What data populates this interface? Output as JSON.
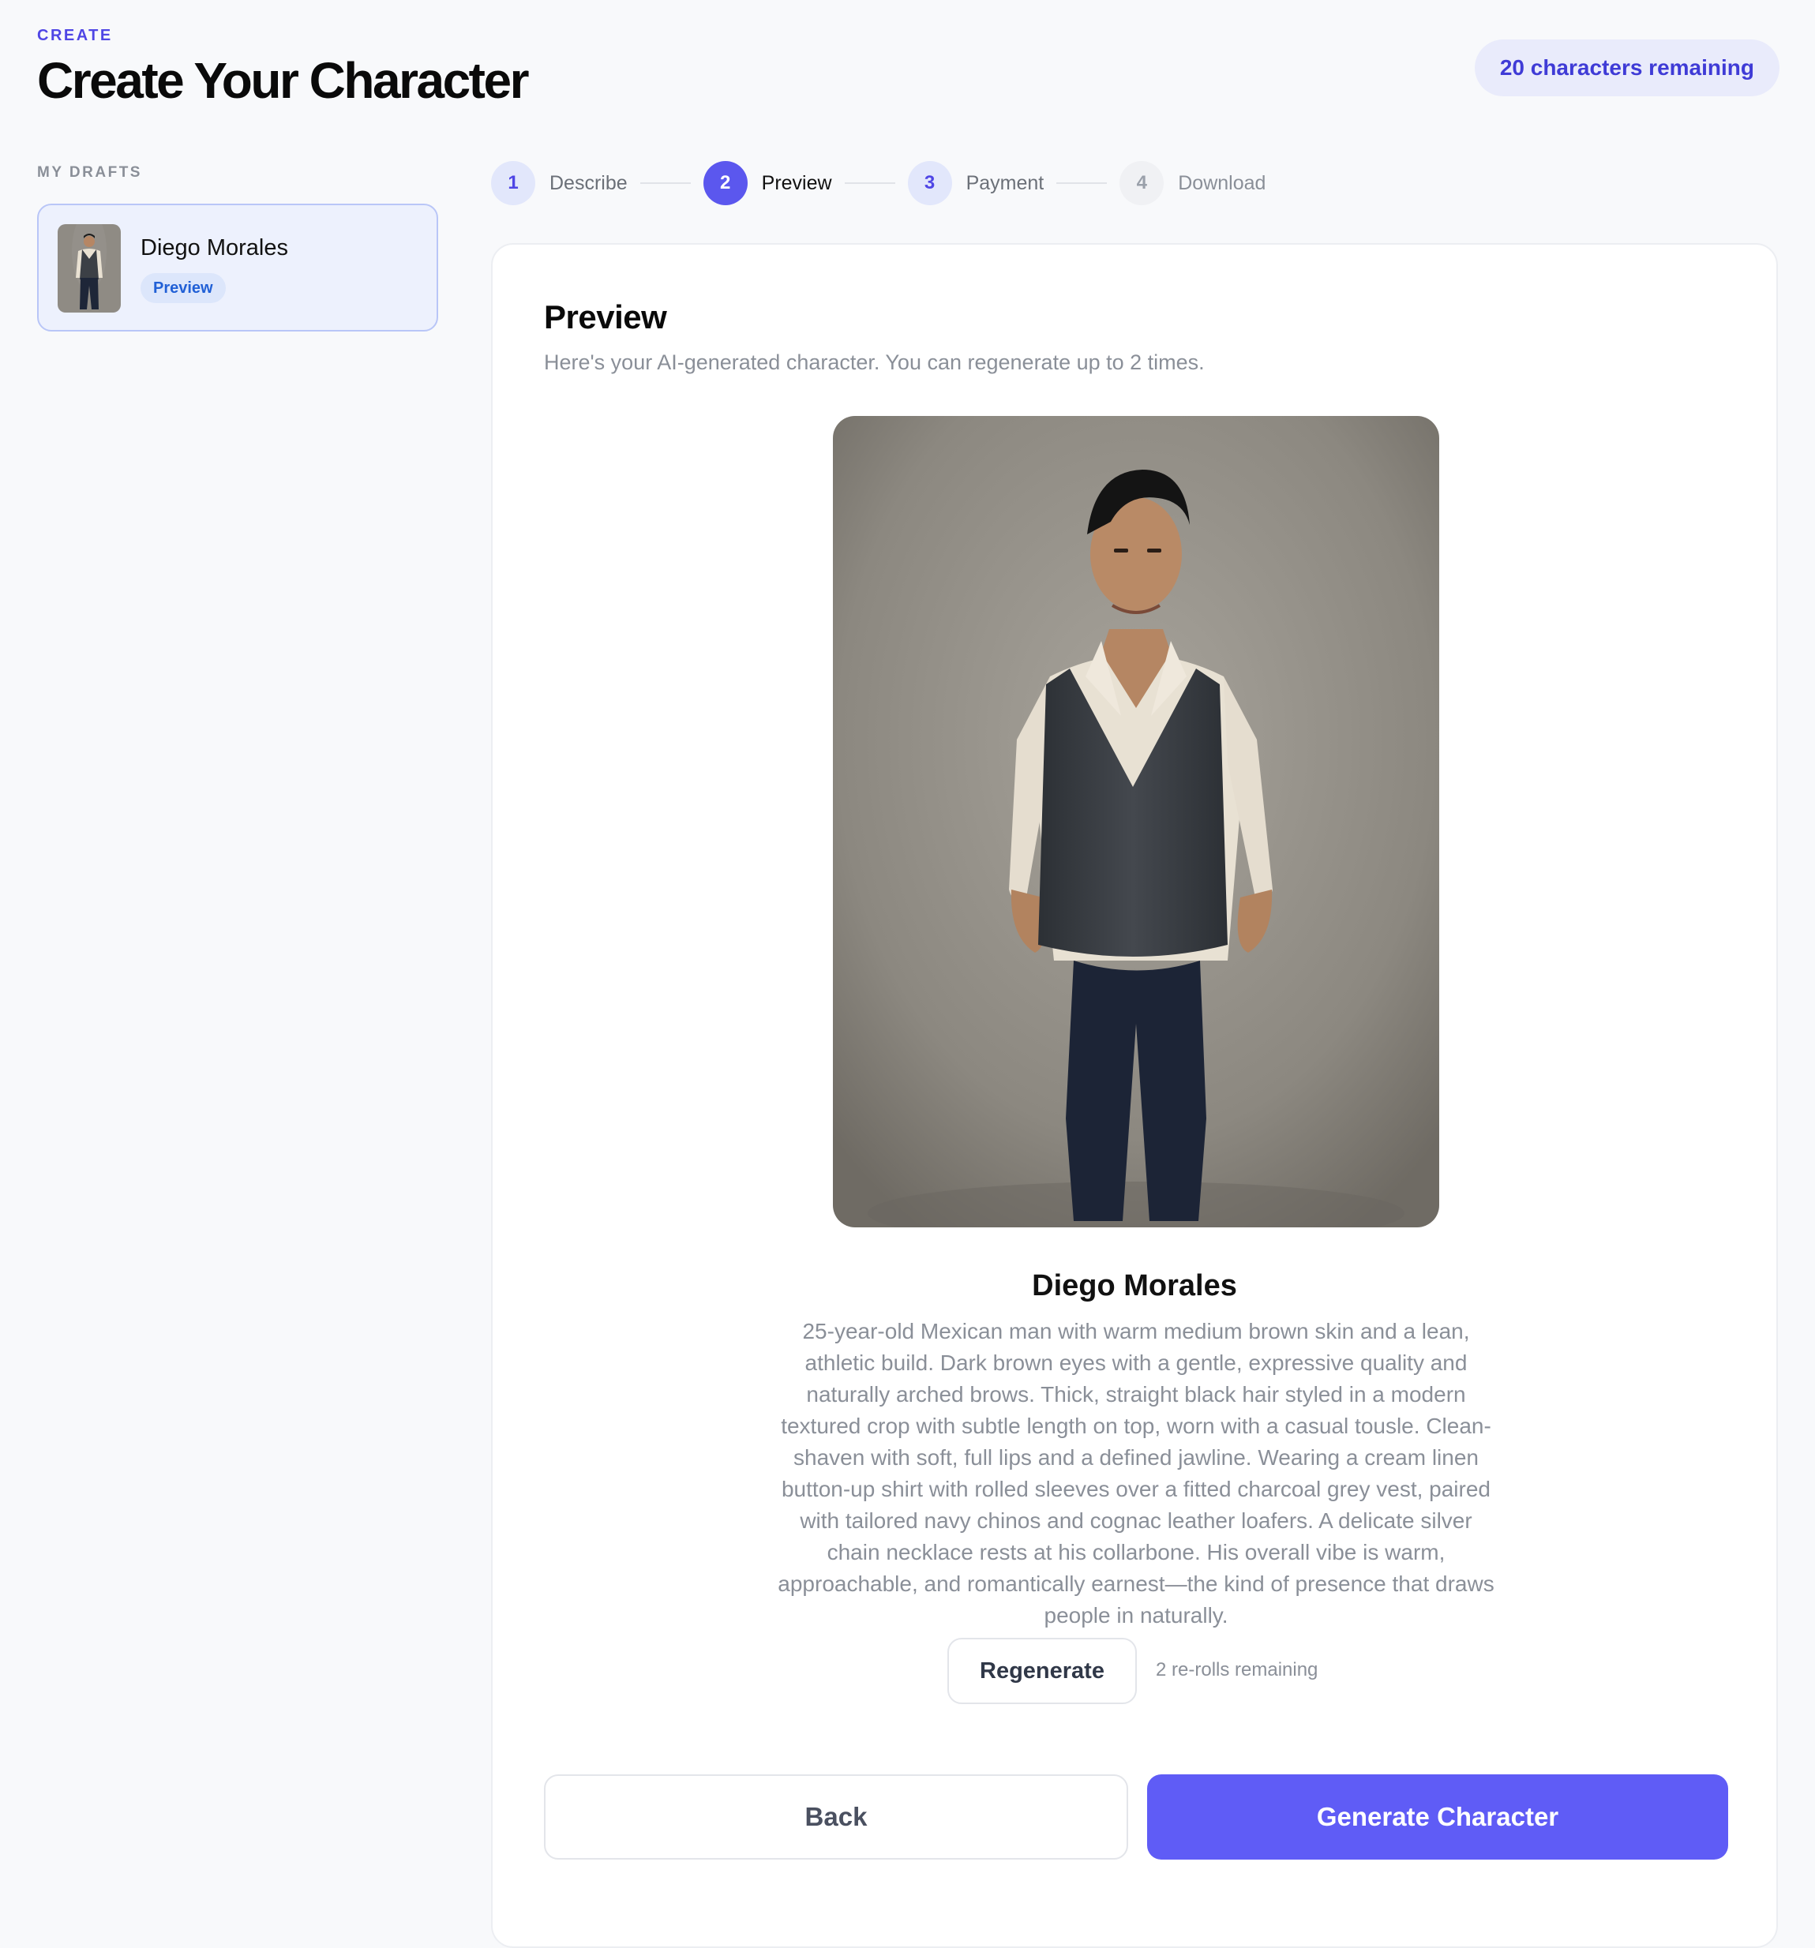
{
  "header": {
    "eyebrow": "CREATE",
    "title": "Create Your Character",
    "remaining": "20 characters remaining"
  },
  "sidebar": {
    "label": "MY DRAFTS",
    "drafts": [
      {
        "name": "Diego Morales",
        "status": "Preview"
      }
    ]
  },
  "stepper": {
    "steps": [
      {
        "number": "1",
        "label": "Describe",
        "state": "done"
      },
      {
        "number": "2",
        "label": "Preview",
        "state": "active"
      },
      {
        "number": "3",
        "label": "Payment",
        "state": "done"
      },
      {
        "number": "4",
        "label": "Download",
        "state": "pending"
      }
    ]
  },
  "preview": {
    "title": "Preview",
    "subtitle": "Here's your AI-generated character. You can regenerate up to 2 times.",
    "character_name": "Diego Morales",
    "description": "25-year-old Mexican man with warm medium brown skin and a lean, athletic build. Dark brown eyes with a gentle, expressive quality and naturally arched brows. Thick, straight black hair styled in a modern textured crop with subtle length on top, worn with a casual tousle. Clean-shaven with soft, full lips and a defined jawline. Wearing a cream linen button-up shirt with rolled sleeves over a fitted charcoal grey vest, paired with tailored navy chinos and cognac leather loafers. A delicate silver chain necklace rests at his collarbone. His overall vibe is warm, approachable, and romantically earnest—the kind of presence that draws people in naturally.",
    "regenerate_label": "Regenerate",
    "rerolls_text": "2 re-rolls remaining",
    "back_label": "Back",
    "generate_label": "Generate Character"
  },
  "colors": {
    "accent": "#5f5cf6",
    "accent_text": "#4f46e5",
    "background": "#f8f9fb"
  }
}
